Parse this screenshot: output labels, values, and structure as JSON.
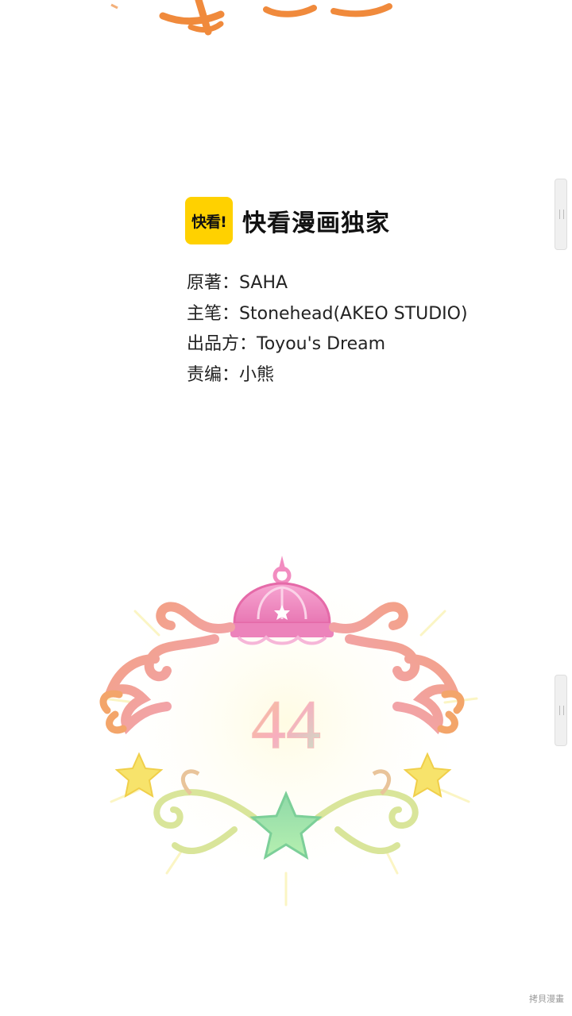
{
  "brand": {
    "logo_text": "快看!",
    "name": "快看漫画独家"
  },
  "credits": [
    {
      "label": "原著：",
      "value": "SAHA"
    },
    {
      "label": "主笔：",
      "value": "Stonehead(AKEO STUDIO)"
    },
    {
      "label": "出品方：",
      "value": "Toyou's Dream"
    },
    {
      "label": "责编：",
      "value": "小熊"
    }
  ],
  "chapter": {
    "number": "44"
  },
  "watermark": "拷貝漫畫",
  "colors": {
    "brand_yellow": "#ffd100",
    "title_orange": "#f08a3c",
    "crown_pink": "#f28cc0",
    "star_green": "#8fe0a0",
    "star_yellow": "#f7e36b"
  },
  "icons": [
    "crown-icon",
    "star-icon"
  ]
}
